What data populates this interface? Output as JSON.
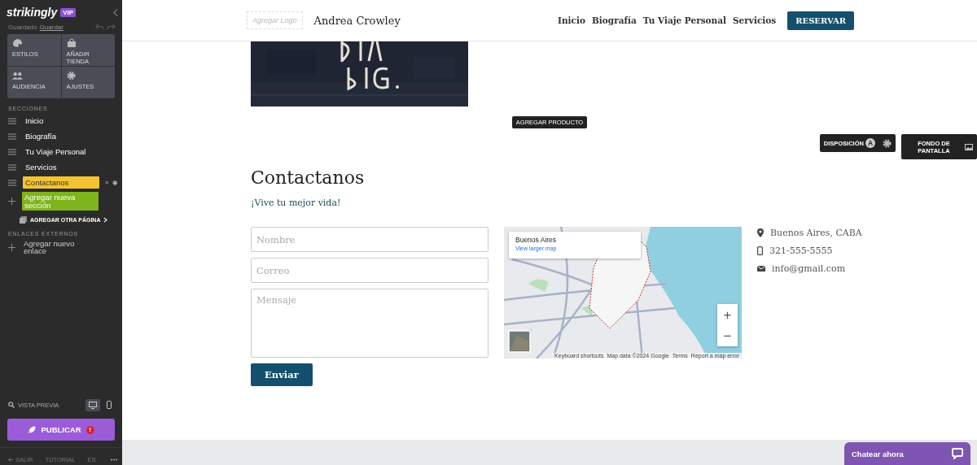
{
  "sidebar": {
    "logo": "strikingly",
    "badge": "VIP",
    "save_status": "Guardado",
    "save_link": "Guardar",
    "tiles": [
      {
        "label": "ESTILOS"
      },
      {
        "label": "AÑADIR TIENDA"
      },
      {
        "label": "AUDIENCIA"
      },
      {
        "label": "AJUSTES"
      }
    ],
    "sections_heading": "SECCIONES",
    "sections": [
      {
        "label": "Inicio",
        "selected": false
      },
      {
        "label": "Biografía",
        "selected": false
      },
      {
        "label": "Tu Viaje Personal",
        "selected": false
      },
      {
        "label": "Servicios",
        "selected": false
      },
      {
        "label": "Contactanos",
        "selected": true
      }
    ],
    "add_section": "Agregar nueva sección",
    "add_page": "AGREGAR OTRA PÁGINA",
    "external_heading": "ENLACES EXTERNOS",
    "add_link": "Agregar nuevo enlace",
    "preview": "VISTA PREVIA",
    "devices": [
      {
        "kind": "desktop",
        "selected": true
      },
      {
        "kind": "mobile",
        "selected": false
      }
    ],
    "publish": "PUBLICAR",
    "publish_alert": "!",
    "footer": [
      "SALIR",
      "TUTORIAL",
      "ES"
    ]
  },
  "header": {
    "logo_placeholder": "Agregar Logo",
    "site_name": "Andrea Crowley",
    "nav": [
      "Inicio",
      "Biografía",
      "Tu Viaje Personal",
      "Servicios"
    ],
    "cta": "RESERVAR"
  },
  "editor": {
    "add_product": "AGREGAR PRODUCTO",
    "layout": "DISPOSICIÓN",
    "layout_badge": "A",
    "background": "FONDO DE PANTALLA"
  },
  "contact": {
    "heading": "Contactanos",
    "subtitle": "¡Vive tu mejor vida!",
    "fields": [
      {
        "kind": "line",
        "placeholder": "Nombre"
      },
      {
        "kind": "line",
        "placeholder": "Correo"
      },
      {
        "kind": "area",
        "placeholder": "Mensaje"
      }
    ],
    "submit": "Enviar",
    "map": {
      "info_title": "Buenos Aires",
      "info_link": "View larger map",
      "zoom_in": "+",
      "zoom_out": "−",
      "attribution": [
        "Keyboard shortcuts",
        "Map data ©2024 Google",
        "Terms",
        "Report a map error"
      ]
    },
    "info": [
      {
        "kind": "location",
        "text": "Buenos Aires, CABA"
      },
      {
        "kind": "phone",
        "text": "321-555-5555"
      },
      {
        "kind": "email",
        "text": "info@gmail.com"
      }
    ]
  },
  "chat": {
    "label": "Chatear ahora"
  }
}
